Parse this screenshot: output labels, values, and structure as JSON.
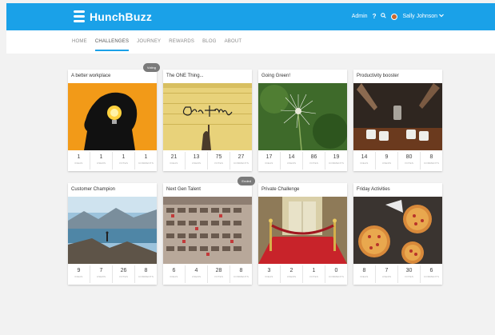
{
  "app": {
    "name": "HunchBuzz"
  },
  "topbar": {
    "admin_label": "Admin",
    "help_label": "?",
    "user_name": "Sally Johnson"
  },
  "nav": {
    "items": [
      {
        "label": "HOME"
      },
      {
        "label": "CHALLENGES"
      },
      {
        "label": "JOURNEY"
      },
      {
        "label": "REWARDS"
      },
      {
        "label": "BLOG"
      },
      {
        "label": "ABOUT"
      }
    ]
  },
  "stat_labels": [
    "IDEAS",
    "USERS",
    "VOTES",
    "COMMENTS"
  ],
  "cards": [
    {
      "title": "A better workplace",
      "badge": "Voting",
      "stats": [
        "1",
        "1",
        "1",
        "1"
      ]
    },
    {
      "title": "The ONE Thing...",
      "badge": "",
      "stats": [
        "21",
        "13",
        "75",
        "27"
      ]
    },
    {
      "title": "Going Green!",
      "badge": "",
      "stats": [
        "17",
        "14",
        "86",
        "19"
      ]
    },
    {
      "title": "Productivity booster",
      "badge": "",
      "stats": [
        "14",
        "9",
        "80",
        "8"
      ]
    },
    {
      "title": "Customer Champion",
      "badge": "",
      "stats": [
        "9",
        "7",
        "26",
        "8"
      ]
    },
    {
      "title": "Next Gen Talent",
      "badge": "Ended",
      "stats": [
        "6",
        "4",
        "28",
        "8"
      ]
    },
    {
      "title": "Private Challenge",
      "badge": "",
      "stats": [
        "3",
        "2",
        "1",
        "0"
      ]
    },
    {
      "title": "Friday Activities",
      "badge": "",
      "stats": [
        "8",
        "7",
        "30",
        "6"
      ]
    }
  ],
  "colors": {
    "brand": "#1aa1e8",
    "background": "#f2f2f2"
  }
}
